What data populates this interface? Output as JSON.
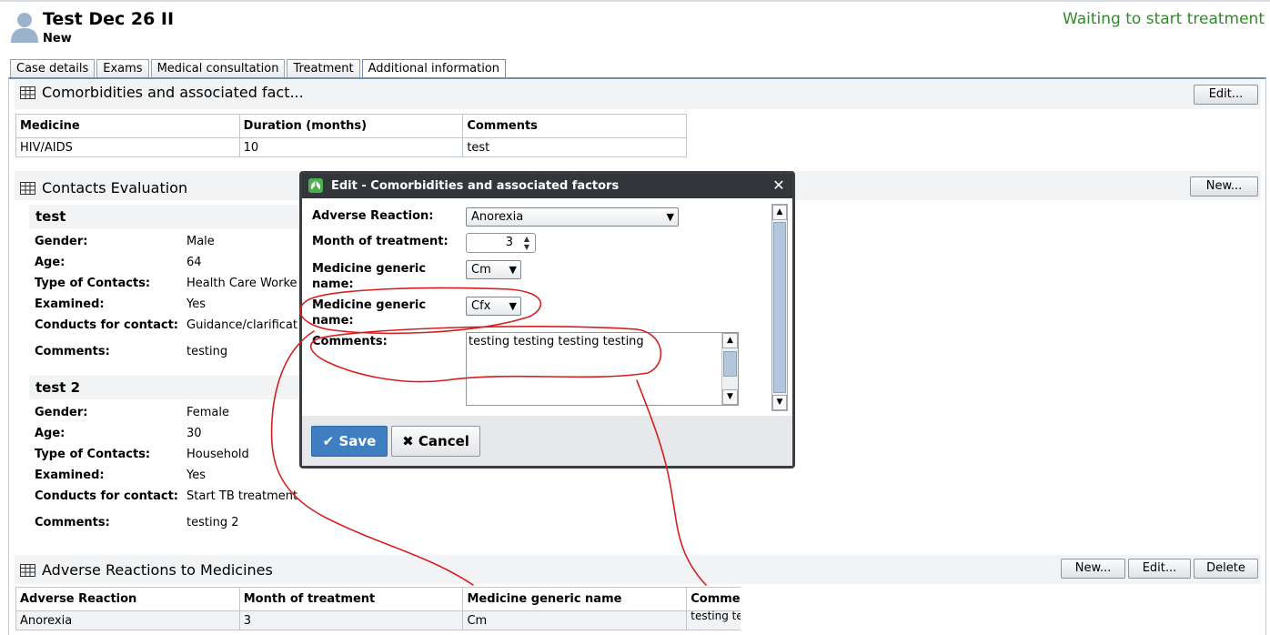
{
  "header": {
    "patient_name": "Test Dec 26 II",
    "patient_status": "New",
    "case_state": "Waiting to start treatment",
    "colors": {
      "case_state": "#2e8b26",
      "tab_border": "#6f8fb3"
    }
  },
  "tabs": [
    {
      "label": "Case details",
      "active": false
    },
    {
      "label": "Exams",
      "active": false
    },
    {
      "label": "Medical consultation",
      "active": false
    },
    {
      "label": "Treatment",
      "active": false
    },
    {
      "label": "Additional information",
      "active": true
    }
  ],
  "comorbidities": {
    "title": "Comorbidities and associated fact...",
    "edit_label": "Edit...",
    "columns": [
      "Medicine",
      "Duration (months)",
      "Comments"
    ],
    "rows": [
      [
        "HIV/AIDS",
        "10",
        "test"
      ]
    ]
  },
  "contacts": {
    "title": "Contacts Evaluation",
    "new_label": "New...",
    "items": [
      {
        "name": "test",
        "fields": [
          {
            "label": "Gender:",
            "value": "Male"
          },
          {
            "label": "Age:",
            "value": "64"
          },
          {
            "label": "Type of Contacts:",
            "value": "Health Care Worke"
          },
          {
            "label": "Examined:",
            "value": "Yes"
          },
          {
            "label": "Conducts for contact:",
            "value": "Guidance/clarificat"
          },
          {
            "label": "Comments:",
            "value": "testing"
          }
        ]
      },
      {
        "name": "test 2",
        "fields": [
          {
            "label": "Gender:",
            "value": "Female"
          },
          {
            "label": "Age:",
            "value": "30"
          },
          {
            "label": "Type of Contacts:",
            "value": "Household"
          },
          {
            "label": "Examined:",
            "value": "Yes"
          },
          {
            "label": "Conducts for contact:",
            "value": "Start TB treatment"
          },
          {
            "label": "Comments:",
            "value": "testing 2"
          }
        ]
      }
    ]
  },
  "adverse": {
    "title": "Adverse Reactions to Medicines",
    "new_label": "New...",
    "edit_label": "Edit...",
    "delete_label": "Delete",
    "columns": [
      "Adverse Reaction",
      "Month of treatment",
      "Medicine generic name",
      "Comme"
    ],
    "rows": [
      [
        "Anorexia",
        "3",
        "Cm",
        "testing testing"
      ]
    ]
  },
  "dialog": {
    "title": "Edit - Comorbidities and associated factors",
    "close_icon": "close-icon",
    "adverse_reaction_label": "Adverse Reaction:",
    "adverse_reaction_value": "Anorexia",
    "month_label": "Month of treatment:",
    "month_value": "3",
    "medicine1_label": "Medicine generic name:",
    "medicine1_value": "Cm",
    "medicine2_label": "Medicine generic name:",
    "medicine2_value": "Cfx",
    "comments_label": "Comments:",
    "comments_value": "testing testing testing testing",
    "save_label": "Save",
    "cancel_label": "Cancel",
    "colors": {
      "save": "#3f7fc1",
      "title_bar": "#33363a"
    }
  },
  "annotations": {
    "color": "#d42020",
    "shape": "freehand-red-ink"
  }
}
